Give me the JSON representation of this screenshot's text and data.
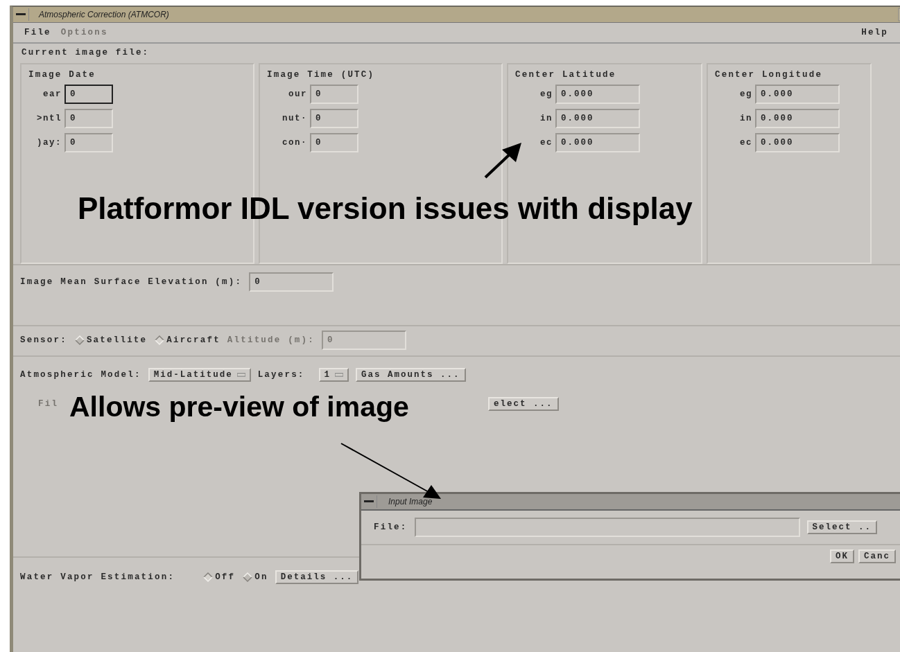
{
  "window": {
    "title": "Atmospheric Correction (ATMCOR)"
  },
  "menu": [
    {
      "label": "File",
      "disabled": false
    },
    {
      "label": "Options",
      "disabled": true
    }
  ],
  "help_menu": "Help",
  "current_file_label": "Current image file:",
  "groups": [
    {
      "title": "Image Date",
      "fields": [
        {
          "label": "ear",
          "value": "0",
          "focused": true
        },
        {
          "label": ">ntl",
          "value": "0",
          "focused": false
        },
        {
          "label": ")ay:",
          "value": "0",
          "focused": false
        }
      ]
    },
    {
      "title": "Image Time (UTC)",
      "fields": [
        {
          "label": "our",
          "value": "0",
          "focused": false
        },
        {
          "label": "nut·",
          "value": "0",
          "focused": false
        },
        {
          "label": "con·",
          "value": "0",
          "focused": false
        }
      ]
    },
    {
      "title": "Center Latitude",
      "fields": [
        {
          "label": "eg",
          "value": "0.000",
          "focused": false
        },
        {
          "label": "in",
          "value": "0.000",
          "focused": false
        },
        {
          "label": "ec",
          "value": "0.000",
          "focused": false
        }
      ]
    },
    {
      "title": "Center Longitude",
      "fields": [
        {
          "label": "eg",
          "value": "0.000",
          "focused": false
        },
        {
          "label": "in",
          "value": "0.000",
          "focused": false
        },
        {
          "label": "ec",
          "value": "0.000",
          "focused": false
        }
      ]
    }
  ],
  "elevation": {
    "label": "Image Mean Surface Elevation (m):",
    "value": "0"
  },
  "sensor": {
    "label": "Sensor:",
    "options": [
      {
        "label": "Satellite",
        "selected": true
      },
      {
        "label": "Aircraft",
        "selected": false
      }
    ],
    "altitude": {
      "label": "Altitude (m):",
      "value": "0",
      "disabled": true
    }
  },
  "atmosphere": {
    "label": "Atmospheric Model:",
    "model": "Mid-Latitude",
    "layers_label": "Layers:",
    "layers": "1",
    "gas_button": "Gas Amounts ...",
    "file_label": "Fil",
    "file_disabled": true,
    "select_button": "elect ..."
  },
  "water_vapor": {
    "label": "Water Vapor Estimation:",
    "options": [
      {
        "label": "Off",
        "selected": false
      },
      {
        "label": "On",
        "selected": true
      }
    ],
    "details_button": "Details ..."
  },
  "dialog": {
    "title": "Input Image",
    "file_label": "File:",
    "select_button": "Select ..",
    "buttons": [
      "OK",
      "Canc"
    ]
  },
  "annotations": [
    {
      "text": "Platformor IDL version issues with display"
    },
    {
      "text": "Allows pre-view of image"
    }
  ]
}
